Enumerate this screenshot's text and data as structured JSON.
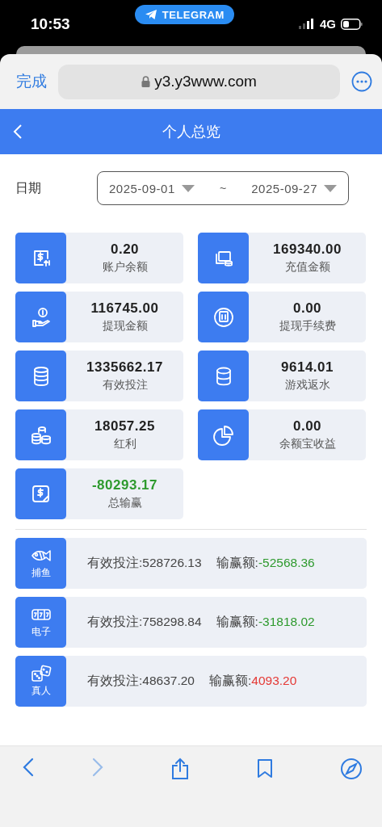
{
  "status_bar": {
    "time": "10:53",
    "app_pill": "TELEGRAM",
    "network": "4G"
  },
  "browser": {
    "done": "完成",
    "address": "y3.y3www.com"
  },
  "header": {
    "title": "个人总览"
  },
  "date_filter": {
    "label": "日期",
    "start": "2025-09-01",
    "separator": "~",
    "end": "2025-09-27"
  },
  "stats": [
    {
      "value": "0.20",
      "label": "账户余额",
      "color": "#222222"
    },
    {
      "value": "169340.00",
      "label": "充值金额",
      "color": "#222222"
    },
    {
      "value": "116745.00",
      "label": "提现金额",
      "color": "#222222"
    },
    {
      "value": "0.00",
      "label": "提现手续费",
      "color": "#222222"
    },
    {
      "value": "1335662.17",
      "label": "有效投注",
      "color": "#222222"
    },
    {
      "value": "9614.01",
      "label": "游戏返水",
      "color": "#222222"
    },
    {
      "value": "18057.25",
      "label": "红利",
      "color": "#222222"
    },
    {
      "value": "0.00",
      "label": "余额宝收益",
      "color": "#222222"
    },
    {
      "value": "-80293.17",
      "label": "总输赢",
      "color": "#2e9a2e"
    }
  ],
  "games": [
    {
      "name": "捕鱼",
      "bet_label": "有效投注:",
      "bet": "528726.13",
      "win_label": "输赢额:",
      "win": "-52568.36",
      "color": "#2e9a2e"
    },
    {
      "name": "电子",
      "bet_label": "有效投注:",
      "bet": "758298.84",
      "win_label": "输赢额:",
      "win": "-31818.02",
      "color": "#2e9a2e"
    },
    {
      "name": "真人",
      "bet_label": "有效投注:",
      "bet": "48637.20",
      "win_label": "输赢额:",
      "win": "4093.20",
      "color": "#e53935"
    }
  ],
  "toolbar": {
    "back": {
      "disabled": false
    },
    "forward": {
      "disabled": true
    }
  }
}
